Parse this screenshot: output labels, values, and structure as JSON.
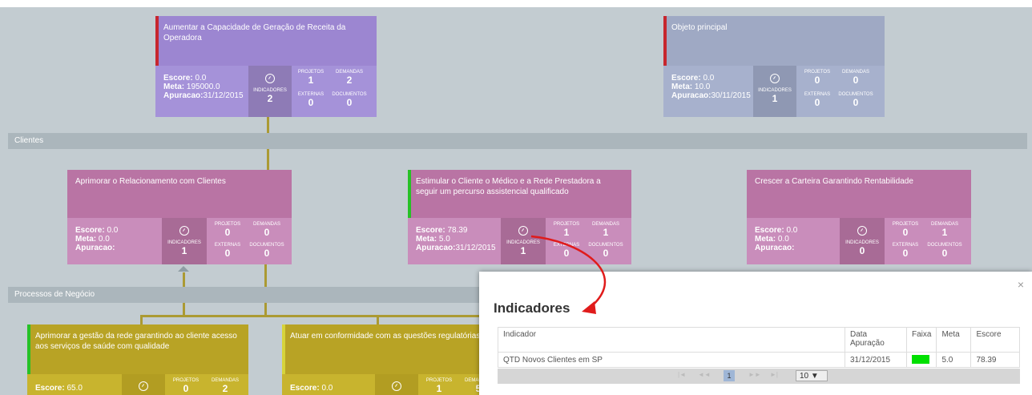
{
  "bands": {
    "clientes": "Clientes",
    "processos": "Processos de Negócio"
  },
  "cards": [
    {
      "id": "c1",
      "title": "Aumentar a Capacidade de Geração de Receita da Operadora",
      "escore": "0.0",
      "meta": "195000.0",
      "apuracao": "31/12/2015",
      "indicadores": "2",
      "projetos": "1",
      "demandas": "2",
      "externas": "0",
      "documentos": "0"
    },
    {
      "id": "c2",
      "title": "Objeto principal",
      "escore": "0.0",
      "meta": "10.0",
      "apuracao": "30/11/2015",
      "indicadores": "1",
      "projetos": "0",
      "demandas": "0",
      "externas": "0",
      "documentos": "0"
    },
    {
      "id": "c3",
      "title": "Aprimorar o Relacionamento com Clientes",
      "escore": "0.0",
      "meta": "0.0",
      "apuracao": "",
      "indicadores": "1",
      "projetos": "0",
      "demandas": "0",
      "externas": "0",
      "documentos": "0"
    },
    {
      "id": "c4",
      "title": "Estimular o Cliente o Médico e a Rede Prestadora a seguir um percurso assistencial qualificado",
      "escore": "78.39",
      "meta": "5.0",
      "apuracao": "31/12/2015",
      "indicadores": "1",
      "projetos": "1",
      "demandas": "1",
      "externas": "0",
      "documentos": "0"
    },
    {
      "id": "c5",
      "title": "Crescer a Carteira Garantindo Rentabilidade",
      "escore": "0.0",
      "meta": "0.0",
      "apuracao": "",
      "indicadores": "0",
      "projetos": "0",
      "demandas": "1",
      "externas": "0",
      "documentos": "0"
    },
    {
      "id": "c6",
      "title": "Aprimorar a gestão da rede garantindo ao cliente acesso aos serviços de saúde com qualidade",
      "escore": "65.0",
      "meta": "",
      "apuracao": "",
      "indicadores": "",
      "projetos": "0",
      "demandas": "2",
      "externas": "",
      "documentos": ""
    },
    {
      "id": "c7",
      "title": "Atuar em conformidade com as questões regulatórias",
      "escore": "0.0",
      "meta": "",
      "apuracao": "",
      "indicadores": "",
      "projetos": "1",
      "demandas": "5",
      "externas": "",
      "documentos": ""
    }
  ],
  "labels": {
    "escore": "Escore:",
    "meta": "Meta:",
    "apuracao": "Apuracao:",
    "indicadores": "INDICADORES",
    "projetos": "PROJETOS",
    "demandas": "DEMANDAS",
    "externas": "EXTERNAS",
    "documentos": "DOCUMENTOS"
  },
  "modal": {
    "title": "Indicadores",
    "close": "×",
    "columns": [
      "Indicador",
      "Data Apuração",
      "Faixa",
      "Meta",
      "Escore"
    ],
    "rows": [
      {
        "indicador": "QTD Novos Clientes em SP",
        "data": "31/12/2015",
        "faixa_color": "#00e000",
        "meta": "5.0",
        "escore": "78.39"
      }
    ],
    "pager": {
      "first": "|◄",
      "prev": "◄◄",
      "page": "1",
      "next": "►►",
      "last": "►|",
      "page_size": "10 ▼"
    }
  },
  "colors": {
    "purple": "#9c86d1",
    "purple_dark": "#a08bd6",
    "slate": "#9fa9c4",
    "pink": "#b974a4",
    "pink_light": "#c98dbb",
    "olive": "#b8a325",
    "olive_light": "#c8b42e",
    "red_marker": "#c7262e",
    "green_marker": "#27c127",
    "connector": "#ab9a33"
  }
}
